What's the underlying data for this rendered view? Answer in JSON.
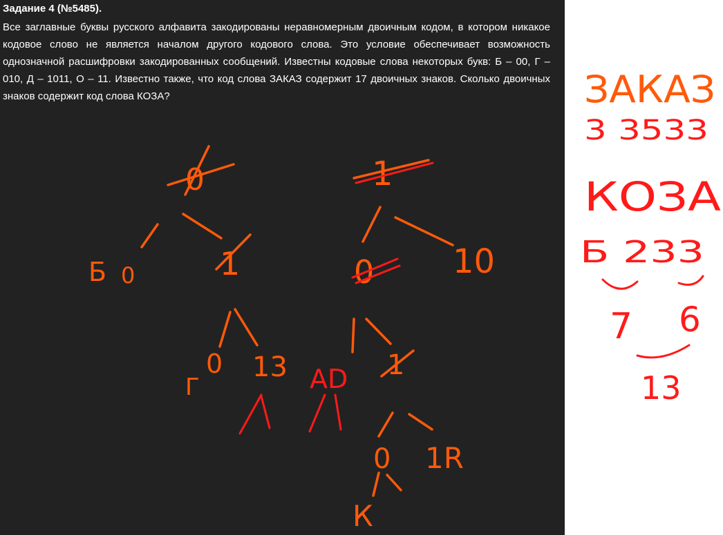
{
  "task": {
    "title": "Задание 4 (№5485).",
    "text": "Все заглавные буквы русского алфавита закодированы неравномерным двоичным кодом, в котором никакое кодовое слово не является началом другого кодового слова. Это условие обеспечивает возможность однозначной расшифровки закодированных сообщений. Известны кодовые слова некоторых букв: Б – 00, Г – 010, Д – 1011, О – 11. Известно также, что код слова ЗАКАЗ содержит 17 двоичных знаков. Сколько двоичных знаков содержит код слова КОЗА?"
  },
  "colors": {
    "board": "#222222",
    "side": "#ffffff",
    "orange_ink": "#ff5a0a",
    "red_ink": "#ff1a1a"
  },
  "sketch": {
    "left_root": "0",
    "right_root": "1",
    "b_label": "Б",
    "b_code": "0",
    "node_01": "1",
    "right_left_node": "0",
    "right_right": "10",
    "g_label": "Г",
    "g_code": "0",
    "num_13": "13",
    "ad_label": "АD",
    "mid_node": "1",
    "bottom_zero": "0",
    "bottom_1r": "1R",
    "k_label": "К"
  },
  "notes": {
    "zakaz": "ЗАКАЗ",
    "zakaz_lengths": "3 3533",
    "koza": "КОЗА",
    "koza_lengths": "Б 233",
    "sum_left": "7",
    "sum_right": "6",
    "total": "13"
  }
}
